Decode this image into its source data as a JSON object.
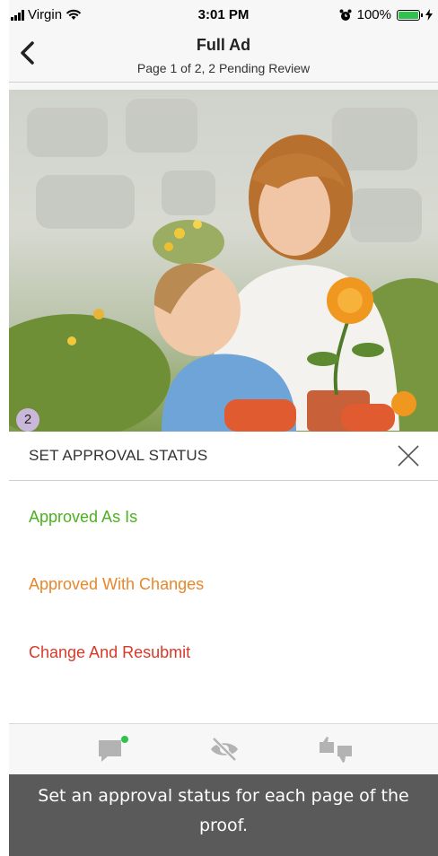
{
  "status_bar": {
    "carrier": "Virgin",
    "time": "3:01 PM",
    "battery_pct": "100%",
    "battery_color": "#2fc34d"
  },
  "nav": {
    "title": "Full Ad",
    "subtitle": "Page 1 of 2, 2 Pending Review",
    "back_icon": "chevron-left-icon"
  },
  "photo": {
    "page_badge": "2"
  },
  "sheet": {
    "title": "SET APPROVAL STATUS",
    "close_icon": "close-icon",
    "options": [
      {
        "label": "Approved As Is",
        "color": "#4cb01f"
      },
      {
        "label": "Approved With Changes",
        "color": "#e8872a"
      },
      {
        "label": "Change And Resubmit",
        "color": "#d83a2a"
      }
    ]
  },
  "toolbar": {
    "icons": [
      "comment-icon",
      "hide-icon",
      "thumbs-icon"
    ],
    "comment_dot_color": "#2fc34d"
  },
  "tooltip": {
    "text": "Set an approval status for each page of the proof."
  }
}
